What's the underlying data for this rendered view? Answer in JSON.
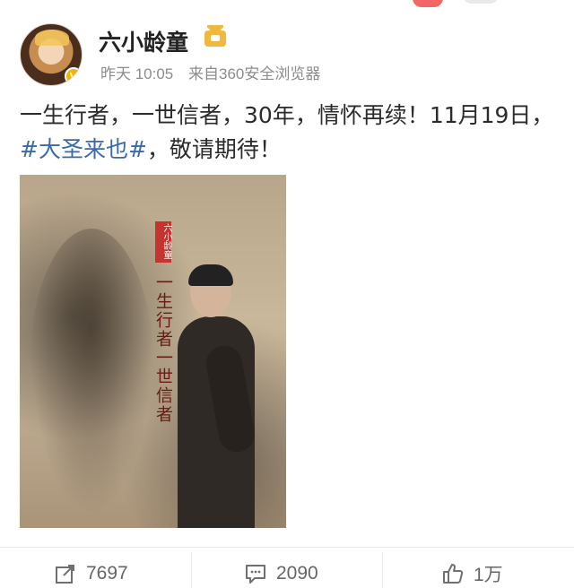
{
  "header": {
    "username": "六小龄童",
    "time": "昨天 10:05",
    "source": "来自360安全浏览器"
  },
  "post": {
    "text_1": "一生行者，一世信者，30年，情怀再续！11月19日，",
    "hashtag": "#大圣来也#",
    "text_2": "，敬请期待！"
  },
  "poster": {
    "seal_text": "六小龄童",
    "slogan": "一生行者一世信者"
  },
  "actions": {
    "repost_count": "7697",
    "comment_count": "2090",
    "like_count": "1万"
  },
  "colors": {
    "accent": "#3a6aa8",
    "muted": "#8c8c8c"
  }
}
